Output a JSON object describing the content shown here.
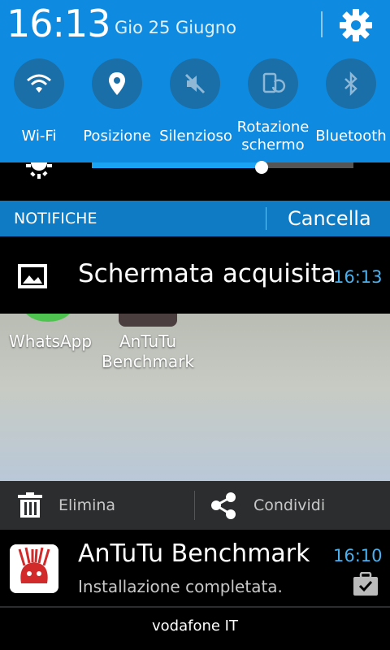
{
  "status": {
    "time": "16:13",
    "date": "Gio 25 Giugno"
  },
  "quick_settings": [
    {
      "label": "Wi-Fi",
      "icon": "wifi-icon"
    },
    {
      "label": "Posizione",
      "icon": "location-icon"
    },
    {
      "label": "Silenzioso",
      "icon": "mute-icon"
    },
    {
      "label": "Rotazione\nschermo",
      "icon": "rotate-icon"
    },
    {
      "label": "Bluetooth",
      "icon": "bluetooth-icon"
    }
  ],
  "brightness": {
    "level": 0.65
  },
  "notifications_bar": {
    "title": "NOTIFICHE",
    "clear": "Cancella"
  },
  "screenshot_notification": {
    "title": "Schermata acquisita",
    "time": "16:13",
    "preview_apps": [
      "WhatsApp",
      "AnTuTu\nBenchmark"
    ],
    "actions": {
      "delete": "Elimina",
      "share": "Condividi"
    }
  },
  "antutu_notification": {
    "title": "AnTuTu Benchmark",
    "time": "16:10",
    "subtitle": "Installazione completata."
  },
  "carrier": "vodafone IT",
  "colors": {
    "header_blue": "#0e8be0",
    "bar_blue": "#0f7bc4",
    "time_blue": "#4ab0ee"
  }
}
